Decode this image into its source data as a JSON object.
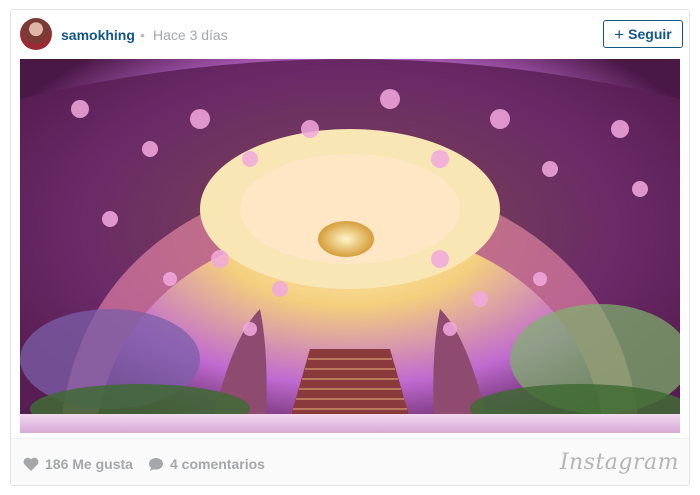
{
  "post": {
    "username": "samokhing",
    "separator": "•",
    "time_ago": "Hace 3 días",
    "follow_label": "Seguir",
    "follow_icon": "plus-icon"
  },
  "photo": {
    "subject": "wedding-stage-flower-arch-image"
  },
  "footer": {
    "likes": "186 Me gusta",
    "comments": "4 comentarios",
    "brand": "Instagram"
  },
  "colors": {
    "accent": "#125688",
    "muted": "#a5a7aa",
    "border": "#e3e3e3"
  }
}
